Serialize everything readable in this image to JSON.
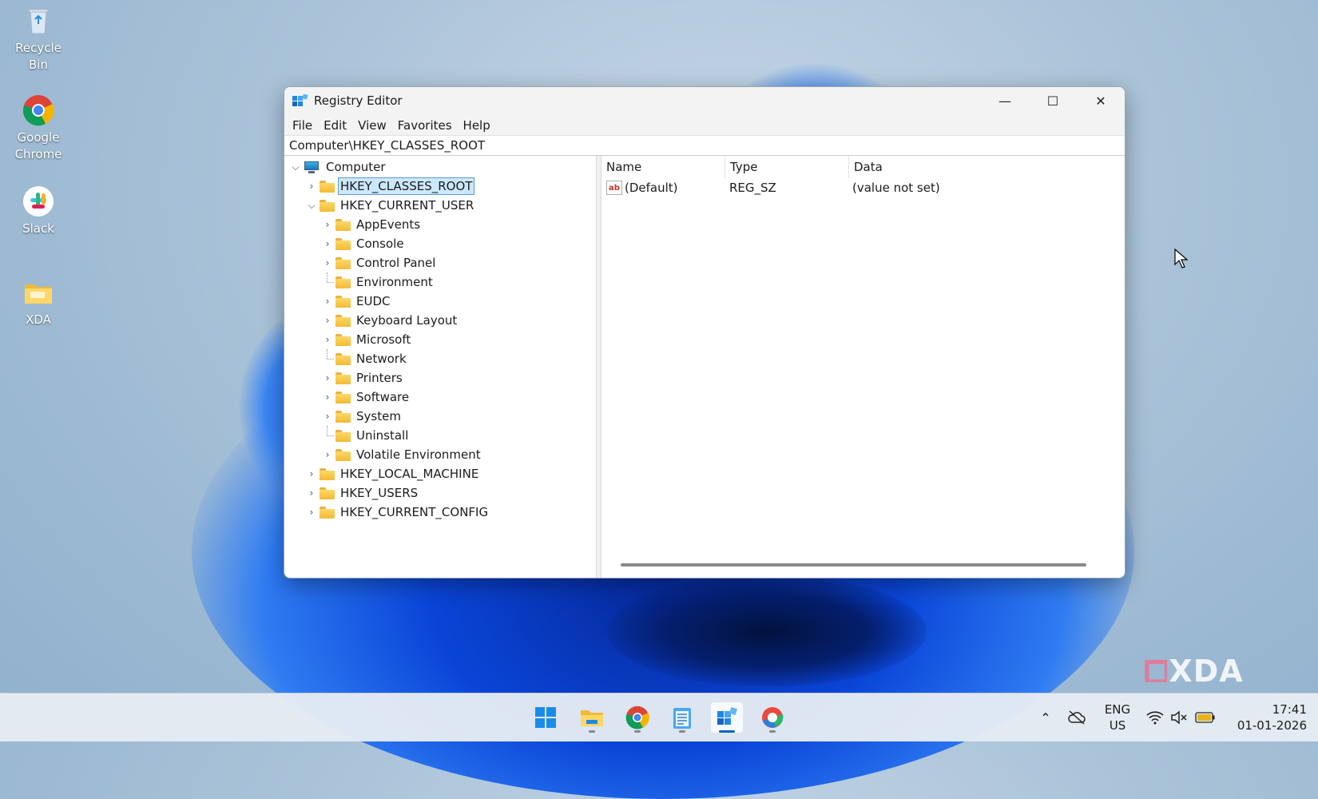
{
  "desktop": {
    "icons": [
      {
        "label": "Recycle Bin"
      },
      {
        "label": "Google Chrome"
      },
      {
        "label": "Slack"
      },
      {
        "label": "XDA"
      }
    ]
  },
  "window": {
    "title": "Registry Editor",
    "controls": {
      "minimize": "—",
      "maximize": "☐",
      "close": "✕"
    },
    "menu": [
      "File",
      "Edit",
      "View",
      "Favorites",
      "Help"
    ],
    "address": "Computer\\HKEY_CLASSES_ROOT"
  },
  "tree": {
    "root": "Computer",
    "hives": [
      "HKEY_CLASSES_ROOT",
      "HKEY_CURRENT_USER",
      "HKEY_LOCAL_MACHINE",
      "HKEY_USERS",
      "HKEY_CURRENT_CONFIG"
    ],
    "current_user_children": [
      "AppEvents",
      "Console",
      "Control Panel",
      "Environment",
      "EUDC",
      "Keyboard Layout",
      "Microsoft",
      "Network",
      "Printers",
      "Software",
      "System",
      "Uninstall",
      "Volatile Environment"
    ],
    "selected": "HKEY_CLASSES_ROOT"
  },
  "values_pane": {
    "columns": [
      "Name",
      "Type",
      "Data"
    ],
    "rows": [
      {
        "name": "(Default)",
        "type": "REG_SZ",
        "data": "(value not set)",
        "icon": "ab"
      }
    ]
  },
  "watermark": "XDA",
  "taskbar": {
    "apps": [
      "start-icon",
      "file-explorer-icon",
      "chrome-icon",
      "notepad-icon",
      "registry-editor-icon",
      "copilot-icon"
    ],
    "active_app": "registry-editor-icon",
    "language": {
      "line1": "ENG",
      "line2": "US"
    },
    "time": "17:41",
    "date": "01-01-2026"
  }
}
